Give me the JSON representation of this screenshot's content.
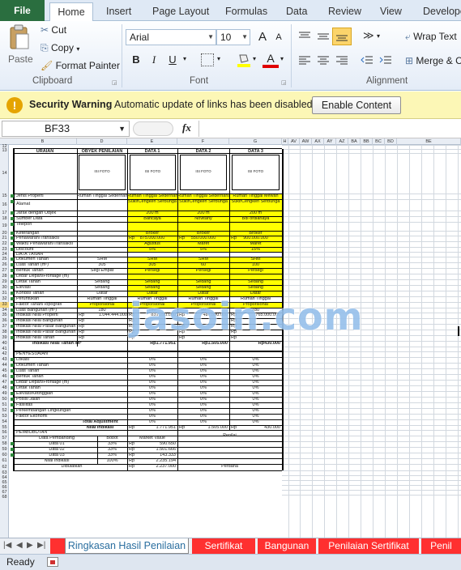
{
  "tabs": [
    "File",
    "Home",
    "Insert",
    "Page Layout",
    "Formulas",
    "Data",
    "Review",
    "View",
    "Develope"
  ],
  "ribbon": {
    "paste": "Paste",
    "cut": "Cut",
    "copy": "Copy",
    "format_painter": "Format Painter",
    "clipboard_label": "Clipboard",
    "font_name": "Arial",
    "font_size": "10",
    "bold": "B",
    "italic": "I",
    "underline": "U",
    "font_label": "Font",
    "wrap_text": "Wrap Text",
    "merge": "Merge & C",
    "alignment_label": "Alignment",
    "grow_font": "A",
    "shrink_font": "A",
    "font_color": "A"
  },
  "security": {
    "title": "Security Warning",
    "message": "Automatic update of links has been disabled",
    "button": "Enable Content"
  },
  "formula_bar": {
    "name_box": "BF33",
    "fx": "fx"
  },
  "columns": [
    "B",
    "D",
    "E",
    "F",
    "G",
    "H",
    "AV",
    "AW",
    "AX",
    "AY",
    "AZ",
    "BA",
    "BB",
    "BC",
    "BD",
    "BE"
  ],
  "rows": [
    "12",
    "13",
    "14",
    "15",
    "16",
    "17",
    "18",
    "19",
    "20",
    "21",
    "22",
    "23",
    "24",
    "25",
    "26",
    "27",
    "28",
    "29",
    "30",
    "31",
    "32",
    "33",
    "34",
    "35",
    "36",
    "37",
    "38",
    "39",
    "40",
    "41",
    "42",
    "43",
    "44",
    "45",
    "46",
    "47",
    "48",
    "49",
    "50",
    "51",
    "52",
    "53",
    "54",
    "55",
    "56",
    "57",
    "58",
    "59",
    "60",
    "61",
    "62",
    "63",
    "64",
    "65",
    "66",
    "67",
    "68"
  ],
  "sheet": {
    "hdr_uraian": "URAIAN",
    "hdr_objek": "OBYEK PENILAIAN",
    "hdr_data1": "DATA 1",
    "hdr_data2": "DATA 2",
    "hdr_data3": "DATA 3",
    "foto": "ISI FOTO",
    "r_jenis": "Jenis Properti",
    "r_alamat": "Alamat",
    "r_jarak": "Jarak dengan Objek",
    "r_sumber": "Sumber Data",
    "r_telepon": "Telepon",
    "r_keterangan": "Keterangan",
    "r_penawaran": "Penawaran/Transaksi",
    "r_waktu": "Waktu Penawaran/Transaksi",
    "r_discount": "Discount",
    "r_data_tanah": "DATA TANAH",
    "r_dokumen": "Dokumen Tanah",
    "r_luas": "Luas Tanah (m²)",
    "r_bentuk": "Bentuk Tanah",
    "r_lebar": "Lebar Depan/Frontage (m)",
    "r_letak": "Letak Tanah",
    "r_elevasi": "Elevasi",
    "r_topografi": "Kondisi Tanah",
    "r_peruntukan": "Peruntukan",
    "r_faktor": "Faktor Tanah/Topografi",
    "r_luas_bangunan": "Luas Bangunan (m²)",
    "r_indikasi_properti": "Indikasi Nilai Properti",
    "r_indikasi_bangunan": "Indikasi Nilai Bangunan",
    "r_indikasi_pasar": "Indikasi Nilai Pasar Bangunan",
    "r_indikasi_pasar2": "Indikasi Nilai Pasar Bangunan",
    "r_indikasi_tanah": "Indikasi Nilai Tanah",
    "r_indikasi_m2": "Indikasi Nilai Tanah /m²",
    "r_penyesuaian": "PENYESUAIAN",
    "r_lokasi": "Lokasi",
    "r_adj_dokumen": "Dokumen Tanah",
    "r_adj_luas": "Luas Tanah",
    "r_adj_bentuk": "Bentuk Tanah",
    "r_adj_lebar": "Lebar Depan/Frontage (m)",
    "r_adj_letak": "Letak Tanah",
    "r_adj_elevasi": "Elevasi/Ketinggian",
    "r_adj_posisi": "Posisi Jalan",
    "r_adj_fasilitas": "Fasilitas",
    "r_adj_perkembangan": "Perkembangan Lingkungan",
    "r_adj_ekonomi": "Faktor Ekonomi",
    "r_total_adj": "Total Adjustment",
    "r_nilai_indikasi": "Nilai Indikasi",
    "r_pembobotan": "PEMBOBOTAN",
    "r_data_pembanding": "Data Pembanding",
    "r_bobot": "Bobot",
    "r_market": "Market Value",
    "r_penilai": "Penilai",
    "r_data01": "Data 01",
    "r_data02": "Data 02",
    "r_data03": "Data 03",
    "r_nilai_indikasi2": "Nilai Indikasi",
    "r_dibulatkan": "Dibulatkan",
    "r_pendana": "Perdana",
    "v_objek_jenis": "Rumah Tinggal Sederhana",
    "v_d1_jenis": "Rumah Tinggal Sederhana",
    "v_d2_jenis": "Rumah Tinggal Sederhana",
    "v_d3_jenis": "Rumah Tinggal Mewah",
    "v_alamat": "SukirCengkeh Serbunga",
    "v_d1_jarak": "200 m",
    "v_d2_jarak": "200 m",
    "v_d3_jarak": "200 m",
    "v_d1_sumber": "Bancaya",
    "v_d2_sumber": "Novitany",
    "v_d3_sumber": "Bdl ordianaya",
    "v_broker": "Broker",
    "v_rp": "Rp",
    "v_d1_penawaran": "875.000.000",
    "v_d2_penawaran": "550.000.000",
    "v_d3_penawaran": "900.000.000",
    "v_d1_waktu": "Agustus",
    "v_d2_waktu": "Maret",
    "v_d3_waktu": "Maret",
    "v_d1_disc": "5%",
    "v_d2_disc": "5%",
    "v_d3_disc": "15%",
    "v_shm": "SHM",
    "v_obj_luas": "305",
    "v_d1_luas": "305",
    "v_d2_luas": "60",
    "v_d3_luas": "100",
    "v_obj_bentuk": "Segi Empat",
    "v_persegi": "Persegi",
    "v_sedang": "Sedang",
    "v_datar": "Datar",
    "v_rumah_tinggal": "Rumah Tinggal",
    "v_proporsional": "Proporsional",
    "v_obj_lb": "180",
    "v_d1_lb": "180",
    "v_d2_lb": "99",
    "v_d3_lb": "180",
    "v_obj_properti": "1.044.444.000",
    "v_d1_properti": "831.250.000",
    "v_d2_properti": "487.500.000",
    "v_d3_properti": "765.000.000",
    "v_indikasi_m2_d1": "Rp1.771.951",
    "v_indikasi_m2_d2": "Rp1.505.000",
    "v_indikasi_m2_d3": "Rp430.000",
    "v_zero": "0%",
    "v_ni_d1": "1.771.951",
    "v_ni_d2": "1.505.000",
    "v_ni_d3": "430.000",
    "v_b1": "33%",
    "v_b2": "33%",
    "v_b3": "33%",
    "v_b_total": "100%",
    "v_m1": "590.650",
    "v_m2": "1.501.666",
    "v_m3": "143.333",
    "v_m_total": "2.235.194",
    "v_m_bulat": "2.237.000"
  },
  "sheet_tabs": [
    "Ringkasan Hasil Penilaian",
    "Sertifikat",
    "Bangunan",
    "Penilaian Sertifikat",
    "Penil"
  ],
  "status": "Ready",
  "watermark": "jasoin.com"
}
